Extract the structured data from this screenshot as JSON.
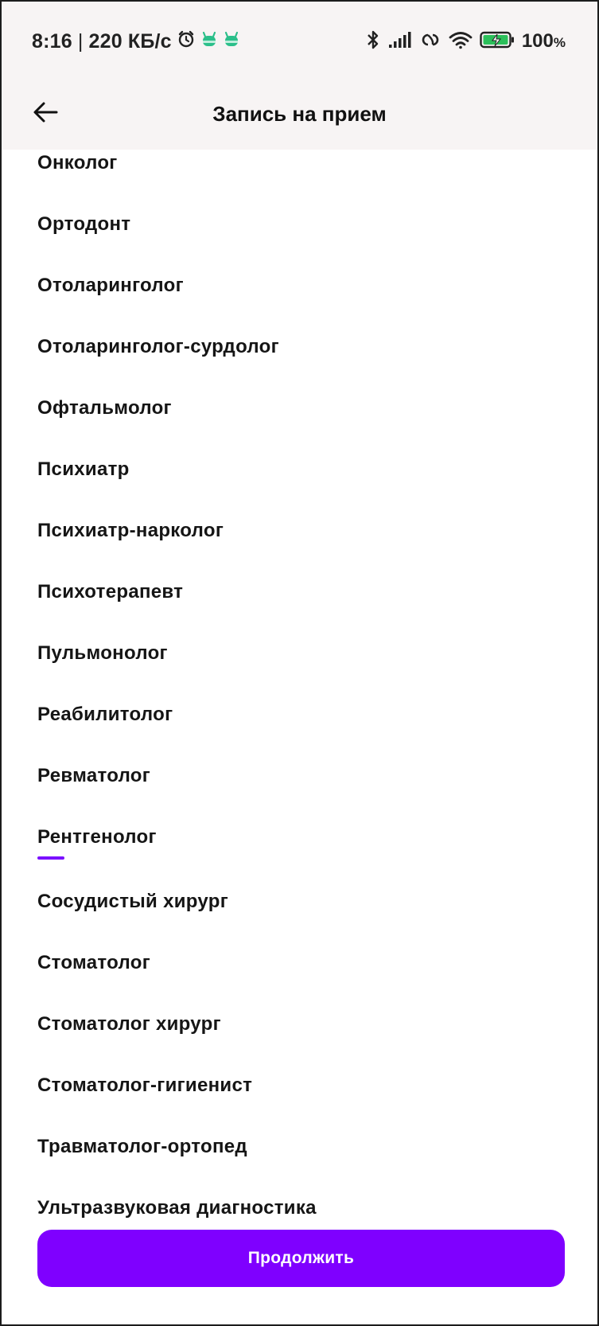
{
  "status_bar": {
    "time": "8:16",
    "separator": "|",
    "speed": "220",
    "speed_unit": "КБ/с",
    "battery_percent": "100",
    "battery_percent_sign": "%"
  },
  "header": {
    "title": "Запись на прием"
  },
  "specialties": [
    "Онколог",
    "Ортодонт",
    "Отоларинголог",
    "Отоларинголог-сурдолог",
    "Офтальмолог",
    "Психиатр",
    "Психиатр-нарколог",
    "Психотерапевт",
    "Пульмонолог",
    "Реабилитолог",
    "Ревматолог",
    "Рентгенолог",
    "Сосудистый хирург",
    "Стоматолог",
    "Стоматолог хирург",
    "Стоматолог-гигиенист",
    "Травматолог-ортопед",
    "Ультразвуковая диагностика"
  ],
  "continue_button": {
    "label": "Продолжить"
  },
  "colors": {
    "accent": "#7f00ff",
    "header_background": "#f7f4f4",
    "app_icon": "#2bbf8a"
  }
}
